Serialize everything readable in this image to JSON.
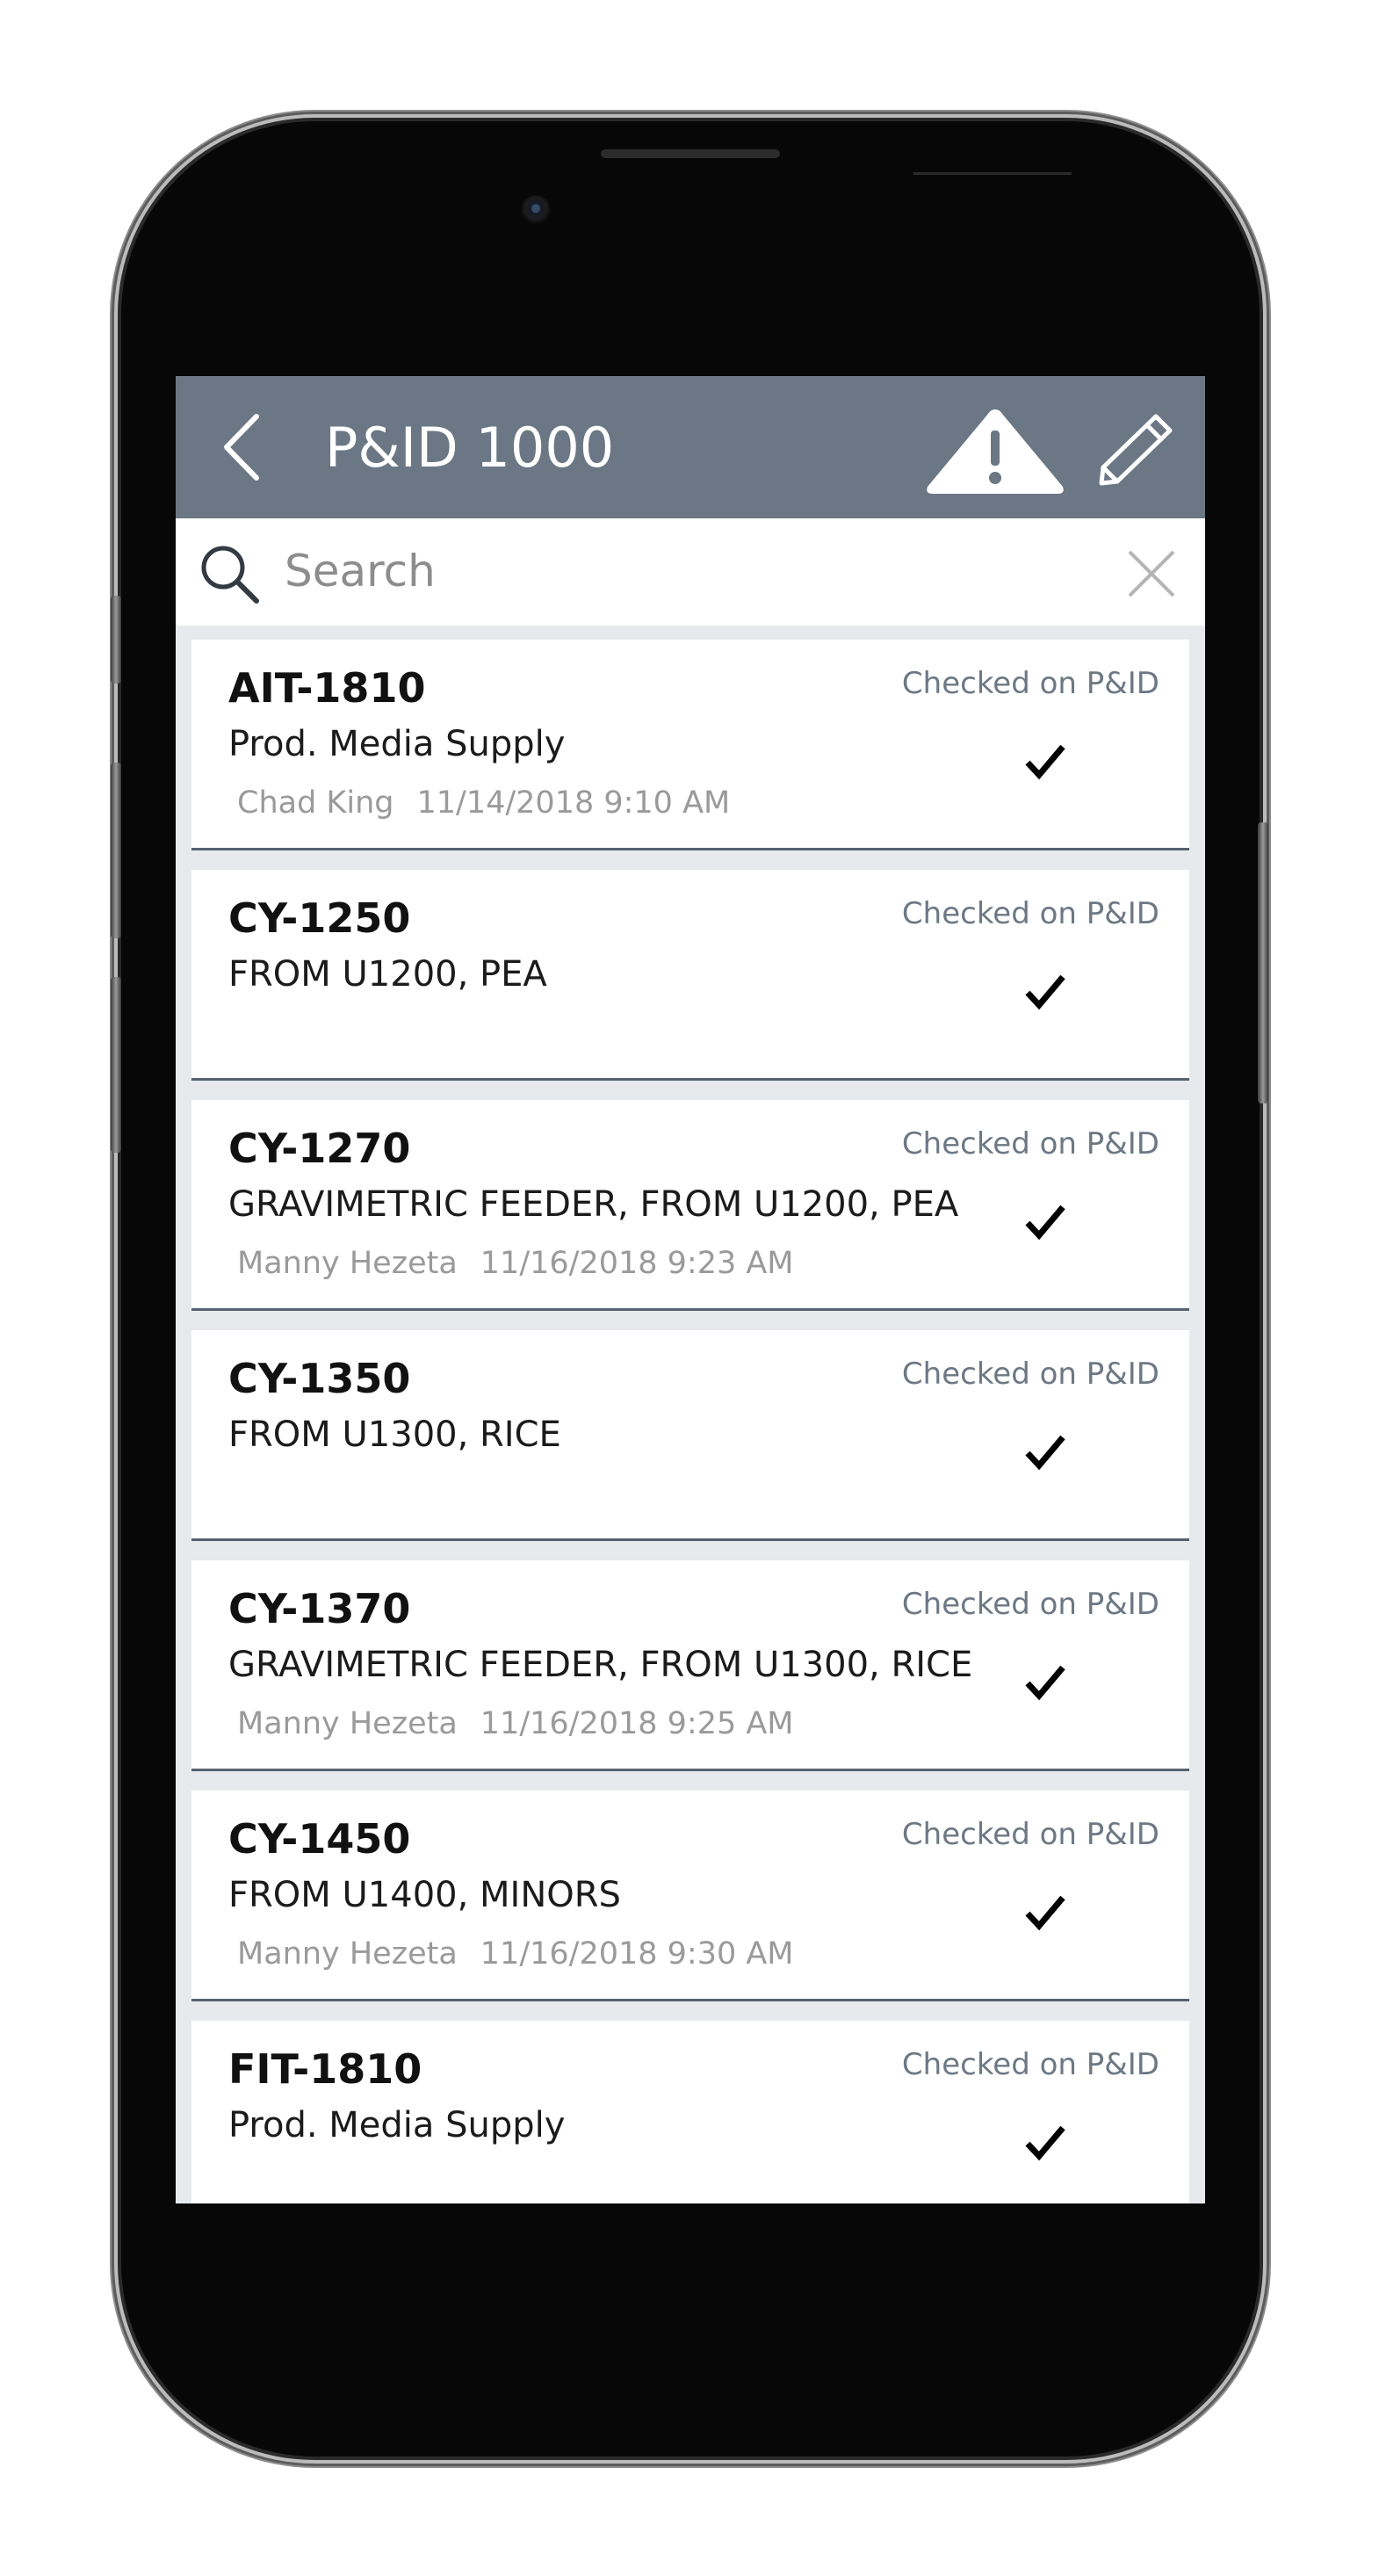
{
  "header": {
    "title": "P&ID 1000",
    "back_icon": "chevron-left-icon",
    "warning_icon": "warning-triangle-icon",
    "edit_icon": "pencil-icon",
    "bg_color": "#6b7784"
  },
  "search": {
    "placeholder": "Search",
    "value": ""
  },
  "items": [
    {
      "id": "AIT-1810",
      "description": "Prod. Media Supply",
      "user": "Chad King",
      "date": "11/14/2018 9:10 AM",
      "status": "Checked on P&ID",
      "checked": true
    },
    {
      "id": "CY-1250",
      "description": "FROM U1200, PEA",
      "user": "",
      "date": "",
      "status": "Checked on P&ID",
      "checked": true
    },
    {
      "id": "CY-1270",
      "description": "GRAVIMETRIC FEEDER, FROM U1200, PEA",
      "user": "Manny Hezeta",
      "date": "11/16/2018 9:23 AM",
      "status": "Checked on P&ID",
      "checked": true
    },
    {
      "id": "CY-1350",
      "description": "FROM U1300, RICE",
      "user": "",
      "date": "",
      "status": "Checked on P&ID",
      "checked": true
    },
    {
      "id": "CY-1370",
      "description": "GRAVIMETRIC FEEDER, FROM U1300, RICE",
      "user": "Manny Hezeta",
      "date": "11/16/2018 9:25 AM",
      "status": "Checked on P&ID",
      "checked": true
    },
    {
      "id": "CY-1450",
      "description": "FROM U1400, MINORS",
      "user": "Manny Hezeta",
      "date": "11/16/2018 9:30 AM",
      "status": "Checked on P&ID",
      "checked": true
    },
    {
      "id": "FIT-1810",
      "description": "Prod. Media Supply",
      "user": "",
      "date": "",
      "status": "Checked on P&ID",
      "checked": true
    }
  ]
}
